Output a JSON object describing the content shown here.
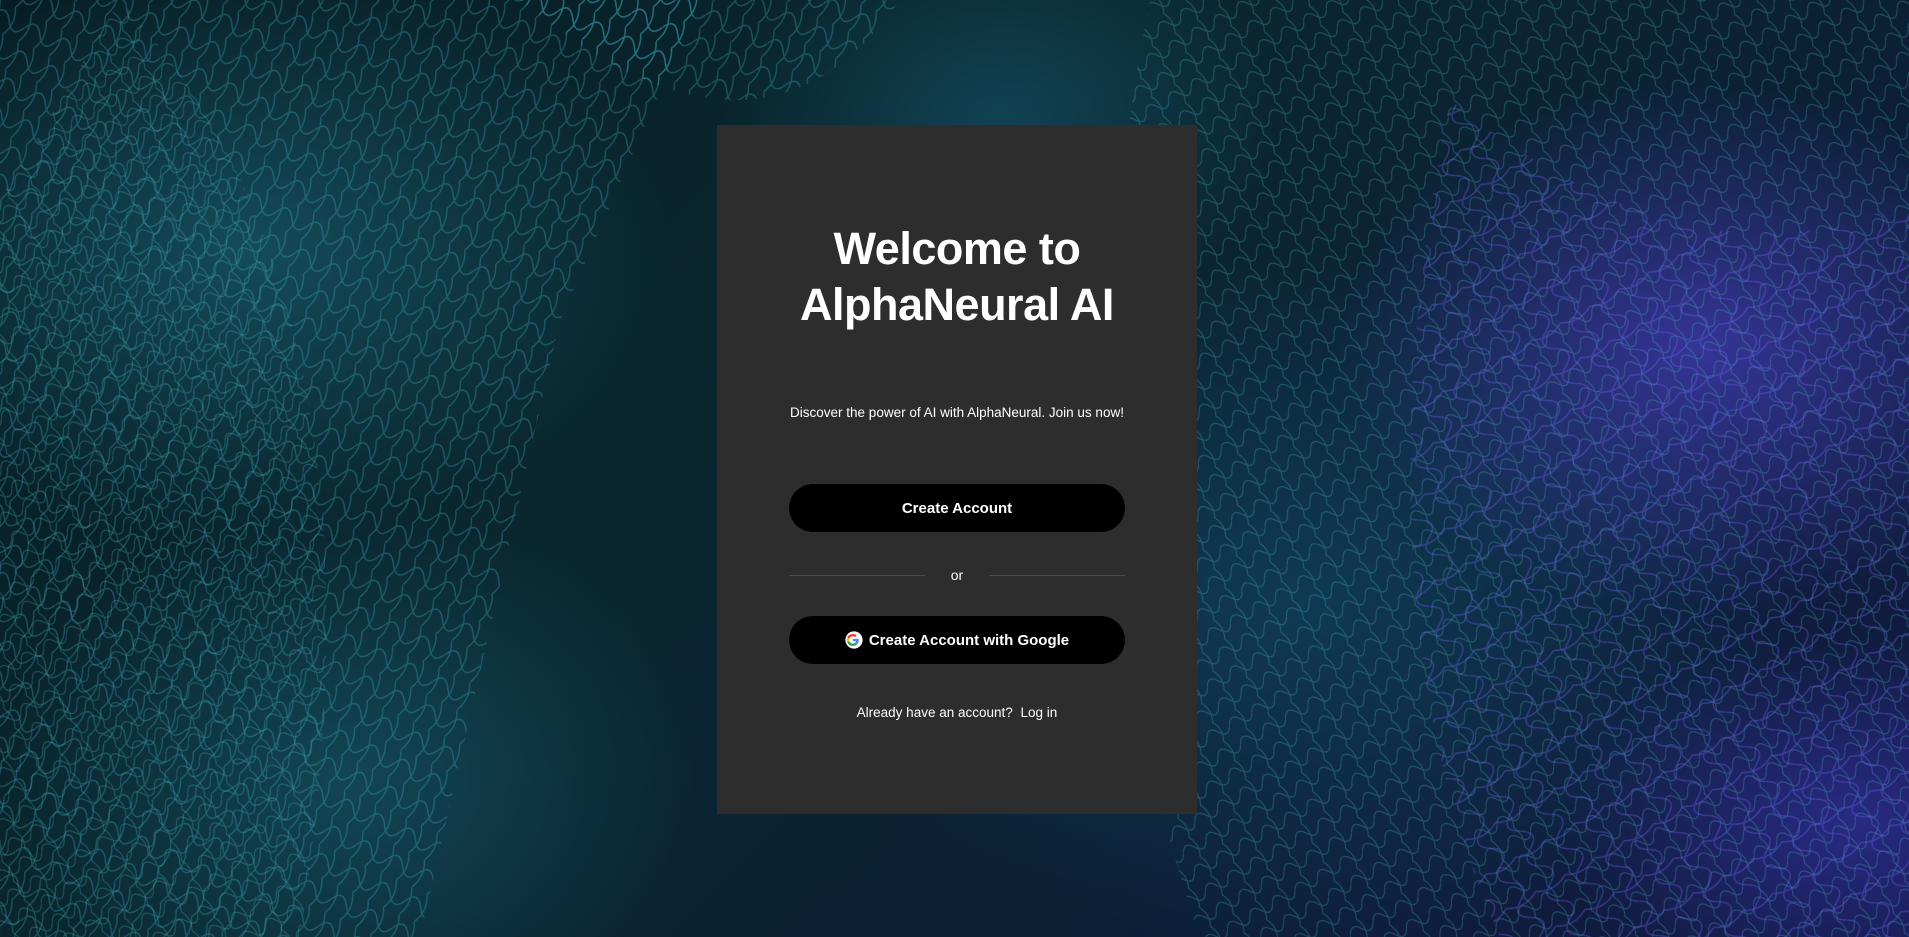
{
  "background": {
    "description_icon": "neural-network-mesh-image",
    "colors": {
      "teal": "#1e6e82",
      "deep": "#071c24",
      "violet": "#5646e6"
    }
  },
  "card": {
    "background": "#2d2d2d",
    "title_line1": "Welcome to",
    "title_line2": "AlphaNeural AI",
    "subtitle": "Discover the power of AI with AlphaNeural. Join us now!",
    "create_account_label": "Create Account",
    "divider_text": "or",
    "google_button_label": "Create Account with Google",
    "google_icon": "google-icon",
    "login_prompt": "Already have an account?",
    "login_link": "Log in"
  }
}
